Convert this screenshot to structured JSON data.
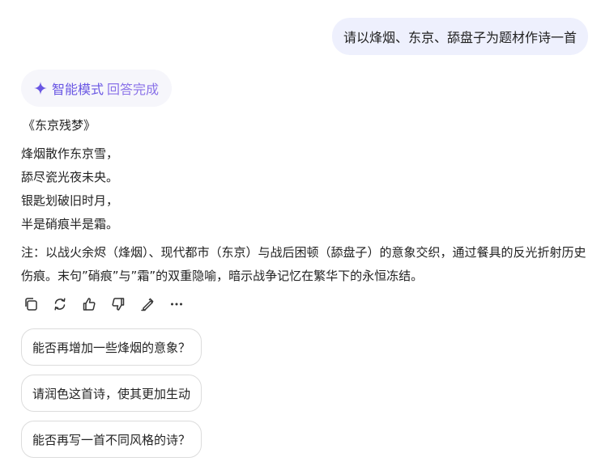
{
  "user_message": "请以烽烟、东京、舔盘子为题材作诗一首",
  "assistant": {
    "mode_label": "智能模式",
    "status_label": "回答完成",
    "poem_title": "《东京残梦》",
    "poem_lines": [
      "烽烟散作东京雪，",
      "舔尽瓷光夜未央。",
      "银匙划破旧时月，",
      "半是硝痕半是霜。"
    ],
    "note": "注：以战火余烬（烽烟）、现代都市（东京）与战后困顿（舔盘子）的意象交织，通过餐具的反光折射历史伤痕。末句”硝痕”与”霜”的双重隐喻，暗示战争记忆在繁华下的永恒冻结。"
  },
  "actions": [
    {
      "icon": "copy-icon"
    },
    {
      "icon": "regenerate-icon"
    },
    {
      "icon": "thumbs-up-icon"
    },
    {
      "icon": "thumbs-down-icon"
    },
    {
      "icon": "edit-icon"
    },
    {
      "icon": "more-icon"
    }
  ],
  "suggestions": [
    "能否再增加一些烽烟的意象？",
    "请润色这首诗，使其更加生动",
    "能否再写一首不同风格的诗？"
  ],
  "colors": {
    "user_bubble_bg": "#eef0fd",
    "accent": "#6a57e3",
    "status": "#8a72e8"
  }
}
